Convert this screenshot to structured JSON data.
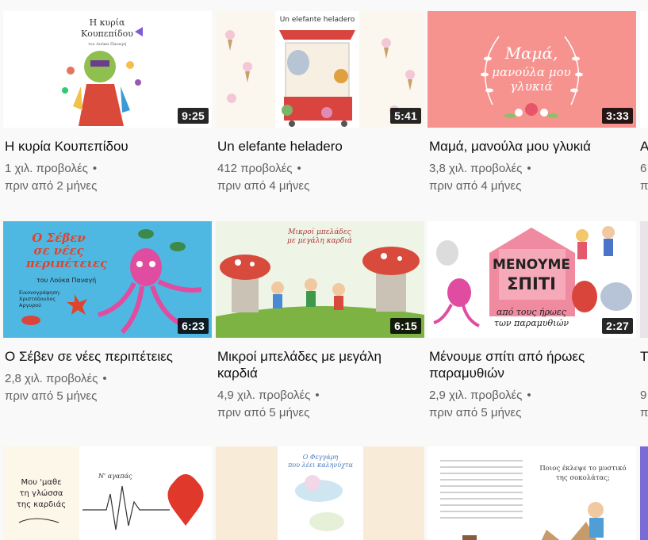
{
  "videos": [
    {
      "title": "Η κυρία Κουπεπίδου",
      "views": "1 χιλ. προβολές",
      "age": "πριν από 2 μήνες",
      "duration": "9:25",
      "thumb_text": [
        "Η κυρία",
        "Κουπεπίδου",
        "του Λούκα Παναγή"
      ]
    },
    {
      "title": "Un elefante heladero",
      "views": "412 προβολές",
      "age": "πριν από 4 μήνες",
      "duration": "5:41",
      "thumb_text": [
        "Un elefante heladero"
      ]
    },
    {
      "title": "Μαμά, μανούλα μου γλυκιά",
      "views": "3,8 χιλ. προβολές",
      "age": "πριν από 4 μήνες",
      "duration": "3:33",
      "thumb_text": [
        "Μαμά,",
        "μανούλα μου",
        "γλυκιά"
      ]
    },
    {
      "title": "Ο Σέβεν σε νέες περιπέτειες",
      "views": "2,8 χιλ. προβολές",
      "age": "πριν από 5 μήνες",
      "duration": "6:23",
      "thumb_text": [
        "Ο Σέβεν",
        "σε νέες",
        "περιπέτειες",
        "του Λούκα Παναγή",
        "Εικονογράφηση:",
        "Χριστόδουλος",
        "Αργυρού"
      ]
    },
    {
      "title": "Μικροί μπελάδες με μεγάλη καρδιά",
      "views": "4,9 χιλ. προβολές",
      "age": "πριν από 5 μήνες",
      "duration": "6:15",
      "thumb_text": [
        "Μικροί μπελάδες",
        "με μεγάλη καρδιά"
      ]
    },
    {
      "title": "Μένουμε σπίτι από ήρωες παραμυθιών",
      "views": "2,9 χιλ. προβολές",
      "age": "πριν από 5 μήνες",
      "duration": "2:27",
      "thumb_text": [
        "ΜΕΝΟΥΜΕ",
        "ΣΠΙΤΙ",
        "από τους ήρωες",
        "των παραμυθιών"
      ]
    },
    {
      "thumb_text": [
        "Μου 'μαθε",
        "τη γλώσσα",
        "της καρδιάς",
        "Ν' αγαπάς"
      ]
    },
    {
      "thumb_text": [
        "Ο Φεγγάρη",
        "που λέει καληνύχτα"
      ]
    },
    {
      "thumb_text": [
        "Ποιος έκλεψε το μυστικό",
        "της σοκολάτας;"
      ]
    }
  ],
  "partial_column": {
    "row1": {
      "title": "A",
      "views": "6",
      "age": "π"
    },
    "row2": {
      "title": "Τ",
      "views": "9",
      "age": "π"
    }
  }
}
